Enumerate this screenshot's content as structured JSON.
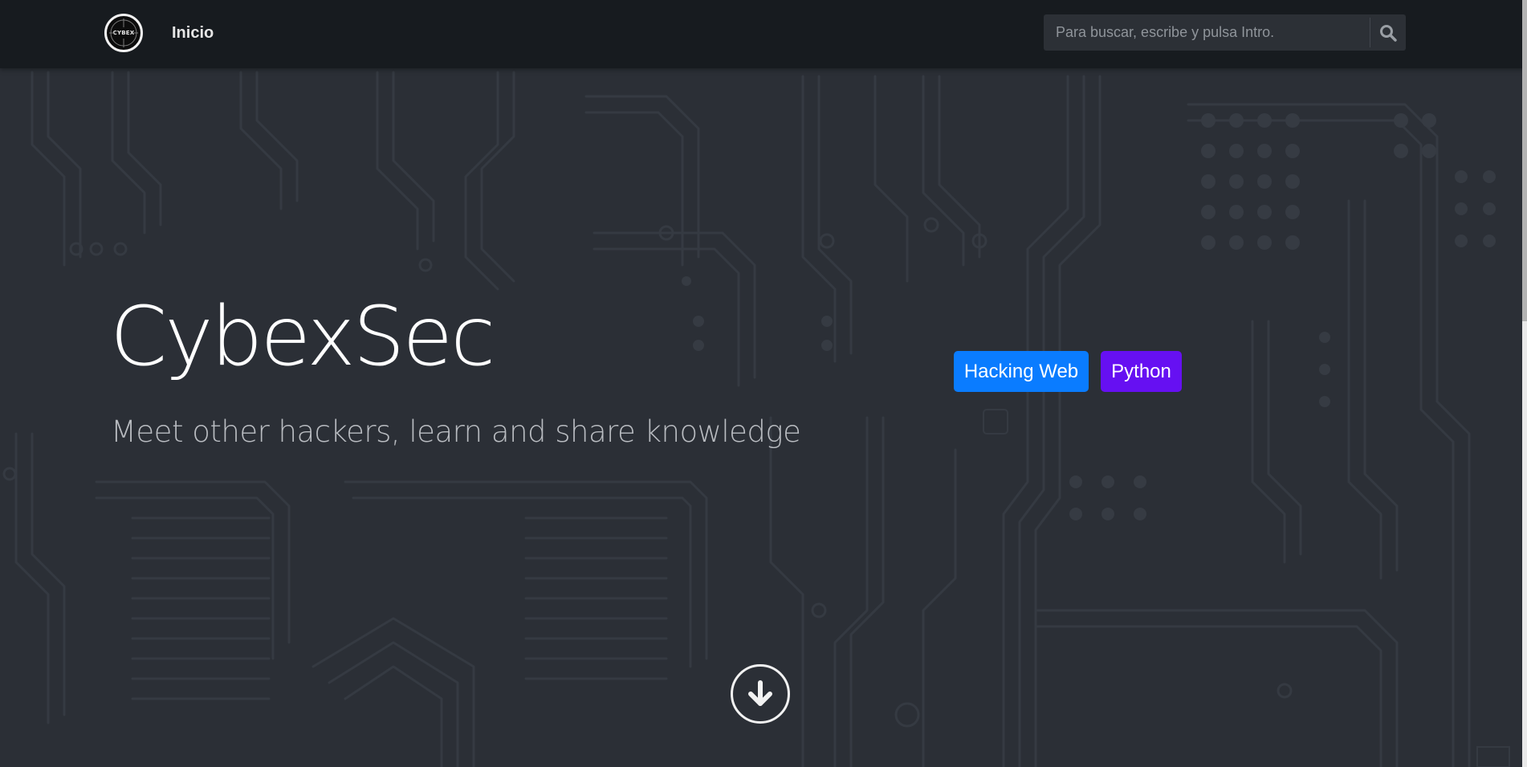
{
  "navbar": {
    "logo_text": "CYBEX",
    "home_link": "Inicio",
    "search": {
      "placeholder": "Para buscar, escribe y pulsa Intro.",
      "icon": "search-icon"
    }
  },
  "hero": {
    "title": "CybexSec",
    "subtitle": "Meet other hackers, learn and share knowledge",
    "tags": [
      {
        "label": "Hacking Web",
        "color": "#0a7cff"
      },
      {
        "label": "Python",
        "color": "#6610f2"
      }
    ],
    "scroll_icon": "arrow-down-circle-icon"
  },
  "colors": {
    "navbar_bg": "#171b1f",
    "page_bg": "#2b2f36",
    "circuit_lines": "#343941",
    "title": "#ffffff",
    "subtitle": "#b9bcc1"
  }
}
